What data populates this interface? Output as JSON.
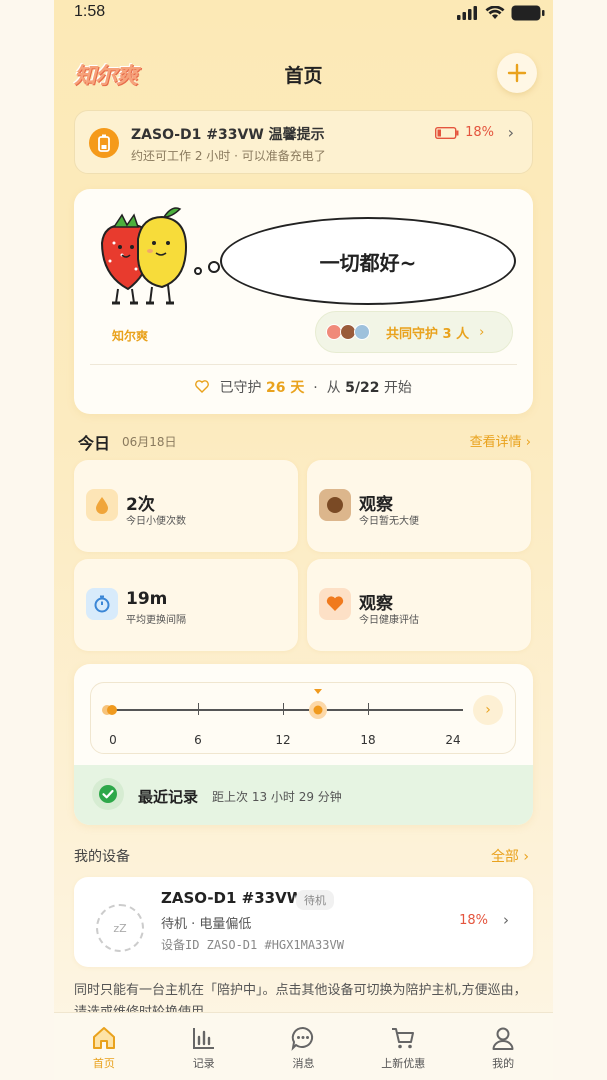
{
  "status_bar": {
    "time": "1:58"
  },
  "header": {
    "logo": "知尔爽",
    "title": "首页"
  },
  "battery_alert": {
    "title": "ZASO-D1 #33VW 温馨提示",
    "subtitle": "约还可工作 2 小时 · 可以准备充电了",
    "battery_percent": "18%"
  },
  "guard_card": {
    "speech": "一切都好~",
    "mascot_label": "知尔爽",
    "co_guard_label": "共同守护 3 人",
    "days_prefix": "已守护",
    "days_value": "26 天",
    "sep": "·",
    "from_prefix": "从",
    "from_date": "5/22",
    "from_suffix": "开始"
  },
  "today": {
    "title": "今日",
    "date": "06月18日",
    "more": "查看详情"
  },
  "stats": [
    {
      "value": "2次",
      "label": "今日小便次数",
      "icon": "droplet-icon"
    },
    {
      "value": "观察",
      "label": "今日暂无大便",
      "icon": "stool-icon"
    },
    {
      "value": "19m",
      "label": "平均更换间隔",
      "icon": "timer-icon"
    },
    {
      "value": "观察",
      "label": "今日健康评估",
      "icon": "heart-icon"
    }
  ],
  "timeline": {
    "ticks": [
      "0",
      "6",
      "12",
      "18",
      "24"
    ],
    "current_hour": 14.5,
    "recent_title": "最近记录",
    "recent_sub": "距上次 13 小时 29 分钟"
  },
  "devices": {
    "title": "我的设备",
    "all": "全部",
    "item": {
      "name": "ZASO-D1 #33VW",
      "badge": "待机",
      "state": "待机 · 电量偏低",
      "id": "设备ID ZASO-D1 #HGX1MA33VW",
      "percent": "18%",
      "avatar_text": "zZ"
    },
    "note": "同时只能有一台主机在「陪护中」。点击其他设备可切换为陪护主机,方便巡由，请选或维修时轮换使用。"
  },
  "tabs": [
    {
      "label": "首页",
      "icon": "home-icon",
      "active": true
    },
    {
      "label": "记录",
      "icon": "chart-icon",
      "active": false
    },
    {
      "label": "消息",
      "icon": "message-icon",
      "active": false
    },
    {
      "label": "上新优惠",
      "icon": "cart-icon",
      "active": false
    },
    {
      "label": "我的",
      "icon": "user-icon",
      "active": false
    }
  ],
  "colors": {
    "accent": "#e9a21d",
    "alert_red": "#e4553e",
    "success_green": "#2ea84a"
  }
}
